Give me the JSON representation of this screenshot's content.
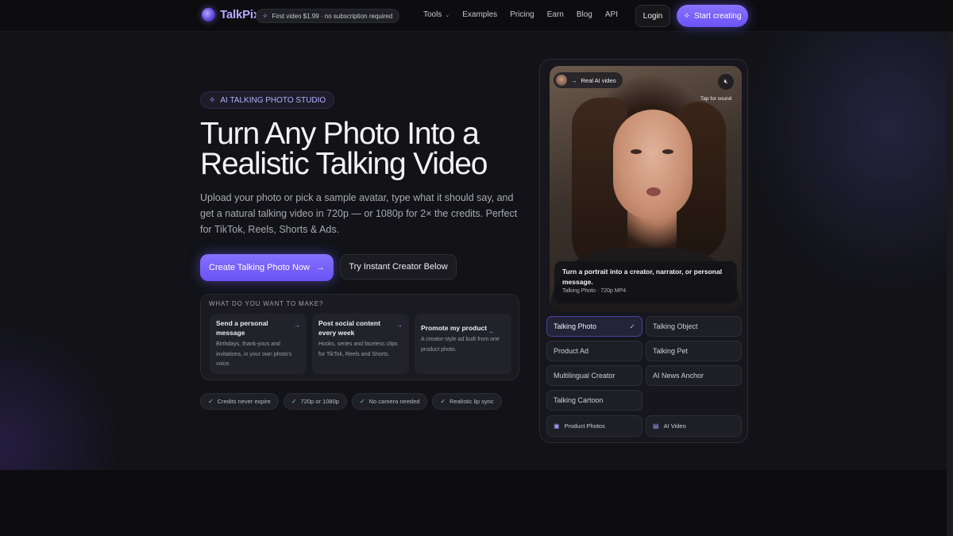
{
  "nav": {
    "brand": "TalkPix",
    "promo": "First video $1.99 · no subscription required",
    "links": [
      "Tools",
      "Examples",
      "Pricing",
      "Earn",
      "Blog",
      "API"
    ],
    "login": "Login",
    "start": "Start creating"
  },
  "hero": {
    "badge": "AI TALKING PHOTO STUDIO",
    "headline_line1": "Turn Any Photo Into a",
    "headline_line2": "Realistic Talking Video",
    "subtext": "Upload your photo or pick a sample avatar, type what it should say, and get a natural talking video in 720p — or 1080p for 2× the credits. Perfect for TikTok, Reels, Shorts & Ads.",
    "cta_primary": "Create Talking Photo Now",
    "cta_secondary": "Try Instant Creator Below"
  },
  "make": {
    "title": "WHAT DO YOU WANT TO MAKE?",
    "options": [
      {
        "title": "Send a personal message",
        "desc": "Birthdays, thank-yous and invitations, in your own photo's voice."
      },
      {
        "title": "Post social content every week",
        "desc": "Hooks, series and faceless clips for TikTok, Reels and Shorts."
      },
      {
        "title": "Promote my product",
        "desc": "A creator-style ad built from one product photo."
      }
    ]
  },
  "chips": [
    "Credits never expire",
    "720p or 1080p",
    "No camera needed",
    "Realistic lip sync"
  ],
  "preview": {
    "pill": "Real AI video",
    "tap": "Tap for sound",
    "caption_title": "Turn a portrait into a creator, narrator, or personal message.",
    "caption_meta": "Talking Photo · 720p MP4"
  },
  "modes": [
    "Talking Photo",
    "Talking Object",
    "Product Ad",
    "Talking Pet",
    "Multilingual Creator",
    "AI News Anchor",
    "Talking Cartoon"
  ],
  "extra_modes": [
    "Product Photos",
    "AI Video"
  ],
  "colors": {
    "accent": "#7b63ff",
    "background": "#121217"
  }
}
